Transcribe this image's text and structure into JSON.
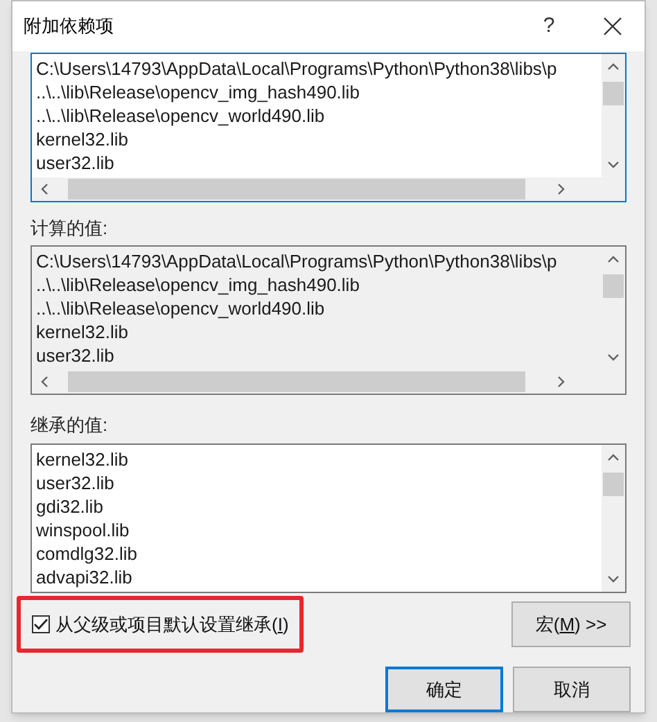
{
  "dialog": {
    "title": "附加依赖项",
    "help": "?"
  },
  "edit_list": {
    "focused": true,
    "disabled": false,
    "lines": [
      "C:\\Users\\14793\\AppData\\Local\\Programs\\Python\\Python38\\libs\\p",
      "..\\..\\lib\\Release\\opencv_img_hash490.lib",
      "..\\..\\lib\\Release\\opencv_world490.lib",
      "kernel32.lib",
      "user32.lib"
    ]
  },
  "computed": {
    "label": "计算的值:",
    "focused": false,
    "disabled": true,
    "lines": [
      "C:\\Users\\14793\\AppData\\Local\\Programs\\Python\\Python38\\libs\\p",
      "..\\..\\lib\\Release\\opencv_img_hash490.lib",
      "..\\..\\lib\\Release\\opencv_world490.lib",
      "kernel32.lib",
      "user32.lib"
    ]
  },
  "inherited": {
    "label": "继承的值:",
    "focused": false,
    "disabled": false,
    "lines": [
      "kernel32.lib",
      "user32.lib",
      "gdi32.lib",
      "winspool.lib",
      "comdlg32.lib",
      "advapi32.lib"
    ]
  },
  "inherit_checkbox": {
    "label_start": "从父级或项目默认设置继承(",
    "access_key": "I",
    "label_end": ")",
    "checked": true,
    "highlighted": true
  },
  "macro_button": {
    "label_start": "宏(",
    "access_key": "M",
    "label_end": ") >>"
  },
  "buttons": [
    {
      "label": "确定",
      "default": true
    },
    {
      "label": "取消",
      "default": false
    }
  ]
}
